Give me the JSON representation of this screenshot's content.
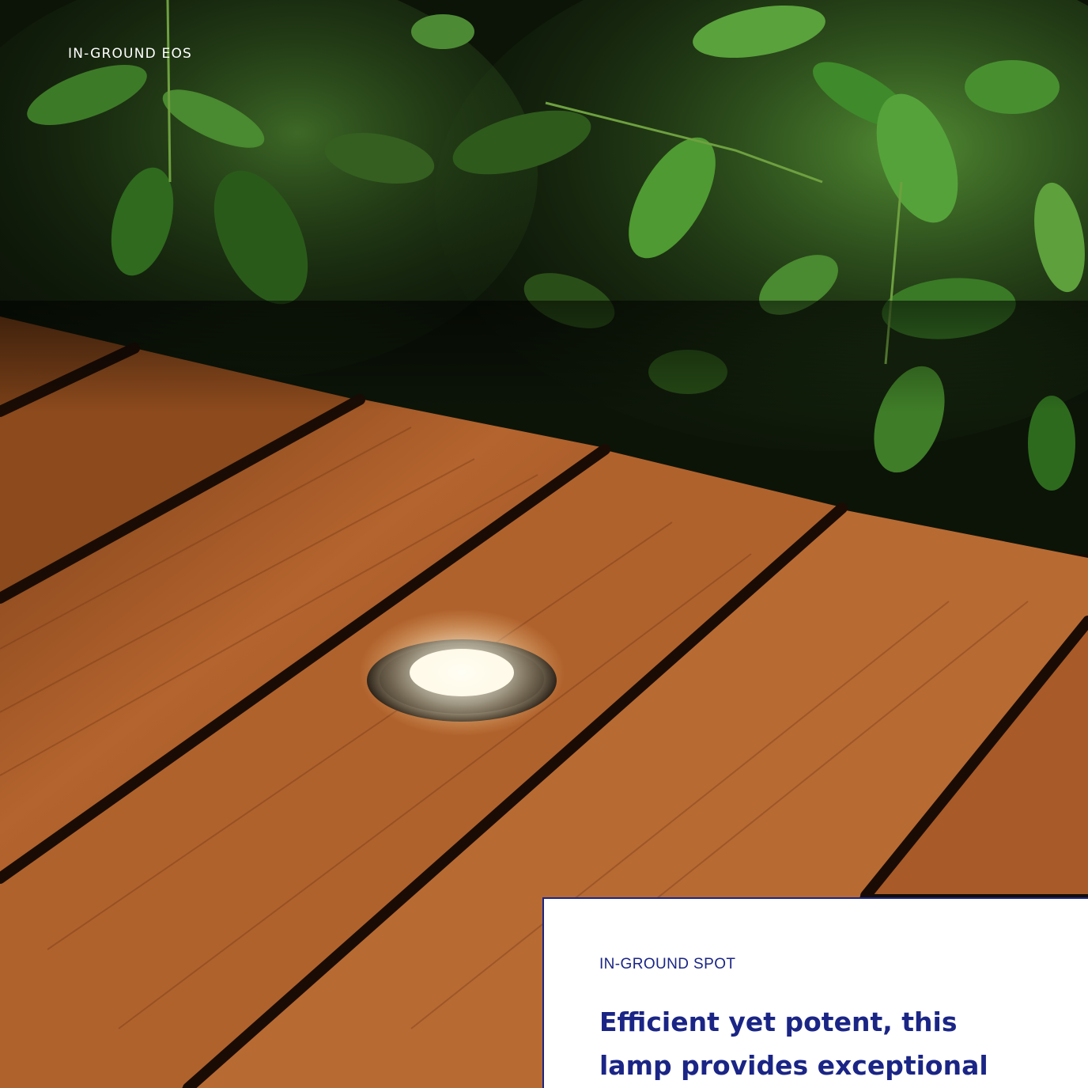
{
  "header": {
    "title": "IN-GROUND EOS"
  },
  "card": {
    "eyebrow": "IN-GROUND SPOT",
    "headline_lines": [
      "Efficient yet potent, this",
      "lamp provides exceptional"
    ]
  },
  "colors": {
    "brand_blue": "#1a2585",
    "wood": "#a85a28",
    "foliage": "#3e7a2a"
  },
  "image": {
    "subject": "in-ground-spot-light-in-wooden-deck"
  }
}
